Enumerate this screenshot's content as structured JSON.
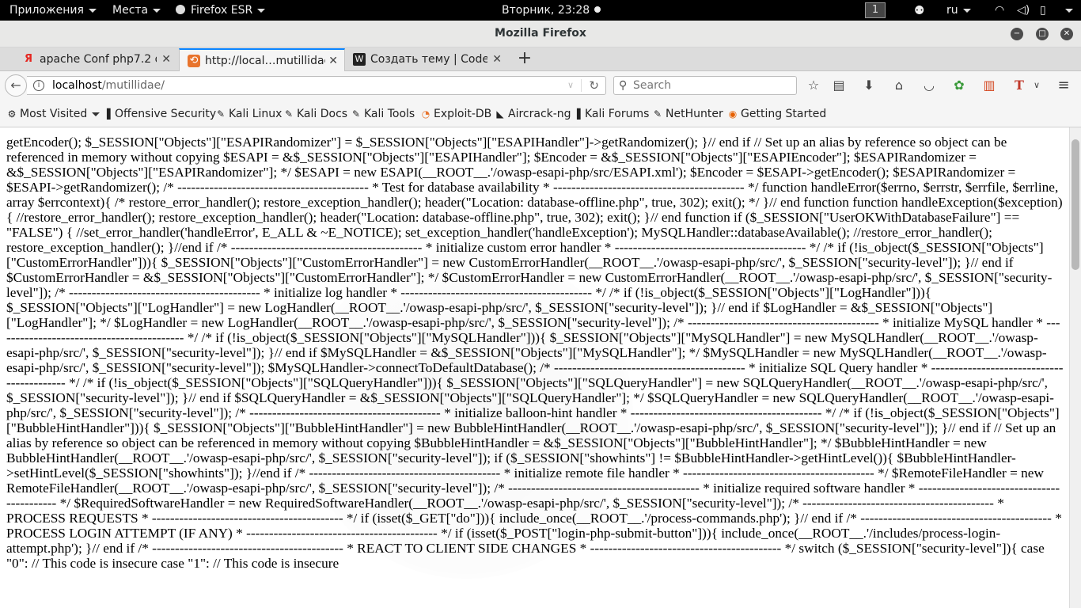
{
  "top_panel": {
    "applications": "Приложения",
    "places": "Места",
    "app_name": "Firefox ESR",
    "clock": "Вторник, 23:28",
    "workspace": "1",
    "language": "ru"
  },
  "window": {
    "title": "Mozilla Firefox",
    "minimize_glyph": "−",
    "maximize_glyph": "□",
    "close_glyph": "✕"
  },
  "tabs": [
    {
      "label": "apache Conf php7.2 d…",
      "icon": "yandex-icon",
      "icon_glyph": "Я",
      "close": "✕"
    },
    {
      "label": "http://local…mutillidae/",
      "icon": "page-icon",
      "icon_glyph": "⟲",
      "close": "✕"
    },
    {
      "label": "Создать тему | Code…",
      "icon": "codeby-icon",
      "icon_glyph": "W",
      "close": "✕"
    }
  ],
  "newtab_glyph": "+",
  "navbar": {
    "back_glyph": "←",
    "url_host": "localhost",
    "url_path": "/mutillidae/",
    "search_placeholder": "Search",
    "search_glyph": "⚲",
    "reload_glyph": "↻"
  },
  "bookmarks": [
    {
      "label": "Most Visited",
      "icon": "star-icon",
      "glyph": "⚙"
    },
    {
      "label": "Offensive Security",
      "icon": "offsec-icon",
      "glyph": "▐"
    },
    {
      "label": "Kali Linux",
      "icon": "kali-icon",
      "glyph": "✎"
    },
    {
      "label": "Kali Docs",
      "icon": "kali-icon",
      "glyph": "✎"
    },
    {
      "label": "Kali Tools",
      "icon": "kali-icon",
      "glyph": "✎"
    },
    {
      "label": "Exploit-DB",
      "icon": "exploit-db-icon",
      "glyph": "◔"
    },
    {
      "label": "Aircrack-ng",
      "icon": "aircrack-icon",
      "glyph": "◣"
    },
    {
      "label": "Kali Forums",
      "icon": "forums-icon",
      "glyph": "▐"
    },
    {
      "label": "NetHunter",
      "icon": "kali-icon",
      "glyph": "✎"
    },
    {
      "label": "Getting Started",
      "icon": "firefox-icon",
      "glyph": "◉"
    }
  ],
  "page_text": "getEncoder(); $_SESSION[\"Objects\"][\"ESAPIRandomizer\"] = $_SESSION[\"Objects\"][\"ESAPIHandler\"]->getRandomizer(); }// end if // Set up an alias by reference so object can be referenced in memory without copying $ESAPI = &$_SESSION[\"Objects\"][\"ESAPIHandler\"]; $Encoder = &$_SESSION[\"Objects\"][\"ESAPIEncoder\"]; $ESAPIRandomizer = &$_SESSION[\"Objects\"][\"ESAPIRandomizer\"]; */ $ESAPI = new ESAPI(__ROOT__.'/owasp-esapi-php/src/ESAPI.xml'); $Encoder = $ESAPI->getEncoder(); $ESAPIRandomizer = $ESAPI->getRandomizer(); /* ------------------------------------------ * Test for database availability * ------------------------------------------ */ function handleError($errno, $errstr, $errfile, $errline, array $errcontext){ /* restore_error_handler(); restore_exception_handler(); header(\"Location: database-offline.php\", true, 302); exit(); */ }// end function function handleException($exception){ //restore_error_handler(); restore_exception_handler(); header(\"Location: database-offline.php\", true, 302); exit(); }// end function if ($_SESSION[\"UserOKWithDatabaseFailure\"] == \"FALSE\") { //set_error_handler('handleError', E_ALL & ~E_NOTICE); set_exception_handler('handleException'); MySQLHandler::databaseAvailable(); //restore_error_handler(); restore_exception_handler(); }//end if /* ------------------------------------------ * initialize custom error handler * ------------------------------------------ */ /* if (!is_object($_SESSION[\"Objects\"][\"CustomErrorHandler\"])){ $_SESSION[\"Objects\"][\"CustomErrorHandler\"] = new CustomErrorHandler(__ROOT__.'/owasp-esapi-php/src/', $_SESSION[\"security-level\"]); }// end if $CustomErrorHandler = &$_SESSION[\"Objects\"][\"CustomErrorHandler\"]; */ $CustomErrorHandler = new CustomErrorHandler(__ROOT__.'/owasp-esapi-php/src/', $_SESSION[\"security-level\"]); /* ------------------------------------------ * initialize log handler * ------------------------------------------ */ /* if (!is_object($_SESSION[\"Objects\"][\"LogHandler\"])){ $_SESSION[\"Objects\"][\"LogHandler\"] = new LogHandler(__ROOT__.'/owasp-esapi-php/src/', $_SESSION[\"security-level\"]); }// end if $LogHandler = &$_SESSION[\"Objects\"][\"LogHandler\"]; */ $LogHandler = new LogHandler(__ROOT__.'/owasp-esapi-php/src/', $_SESSION[\"security-level\"]); /* ------------------------------------------ * initialize MySQL handler * ------------------------------------------ */ /* if (!is_object($_SESSION[\"Objects\"][\"MySQLHandler\"])){ $_SESSION[\"Objects\"][\"MySQLHandler\"] = new MySQLHandler(__ROOT__.'/owasp-esapi-php/src/', $_SESSION[\"security-level\"]); }// end if $MySQLHandler = &$_SESSION[\"Objects\"][\"MySQLHandler\"]; */ $MySQLHandler = new MySQLHandler(__ROOT__.'/owasp-esapi-php/src/', $_SESSION[\"security-level\"]); $MySQLHandler->connectToDefaultDatabase(); /* ------------------------------------------ * initialize SQL Query handler * ------------------------------------------ */ /* if (!is_object($_SESSION[\"Objects\"][\"SQLQueryHandler\"])){ $_SESSION[\"Objects\"][\"SQLQueryHandler\"] = new SQLQueryHandler(__ROOT__.'/owasp-esapi-php/src/', $_SESSION[\"security-level\"]); }// end if $SQLQueryHandler = &$_SESSION[\"Objects\"][\"SQLQueryHandler\"]; */ $SQLQueryHandler = new SQLQueryHandler(__ROOT__.'/owasp-esapi-php/src/', $_SESSION[\"security-level\"]); /* ------------------------------------------ * initialize balloon-hint handler * ------------------------------------------ */ /* if (!is_object($_SESSION[\"Objects\"][\"BubbleHintHandler\"])){ $_SESSION[\"Objects\"][\"BubbleHintHandler\"] = new BubbleHintHandler(__ROOT__.'/owasp-esapi-php/src/', $_SESSION[\"security-level\"]); }// end if // Set up an alias by reference so object can be referenced in memory without copying $BubbleHintHandler = &$_SESSION[\"Objects\"][\"BubbleHintHandler\"]; */ $BubbleHintHandler = new BubbleHintHandler(__ROOT__.'/owasp-esapi-php/src/', $_SESSION[\"security-level\"]); if ($_SESSION[\"showhints\"] != $BubbleHintHandler->getHintLevel()){ $BubbleHintHandler->setHintLevel($_SESSION[\"showhints\"]); }//end if /* ------------------------------------------ * initialize remote file handler * ------------------------------------------ */ $RemoteFileHandler = new RemoteFileHandler(__ROOT__.'/owasp-esapi-php/src/', $_SESSION[\"security-level\"]); /* ------------------------------------------ * initialize required software handler * ------------------------------------------ */ $RequiredSoftwareHandler = new RequiredSoftwareHandler(__ROOT__.'/owasp-esapi-php/src/', $_SESSION[\"security-level\"]); /* ------------------------------------------ * PROCESS REQUESTS * ------------------------------------------ */ if (isset($_GET[\"do\"])){ include_once(__ROOT__.'/process-commands.php'); }// end if /* ------------------------------------------ * PROCESS LOGIN ATTEMPT (IF ANY) * ------------------------------------------ */ if (isset($_POST[\"login-php-submit-button\"])){ include_once(__ROOT__.'/includes/process-login-attempt.php'); }// end if /* ------------------------------------------ * REACT TO CLIENT SIDE CHANGES * ------------------------------------------ */ switch ($_SESSION[\"security-level\"]){ case \"0\": // This code is insecure case \"1\": // This code is insecure"
}
